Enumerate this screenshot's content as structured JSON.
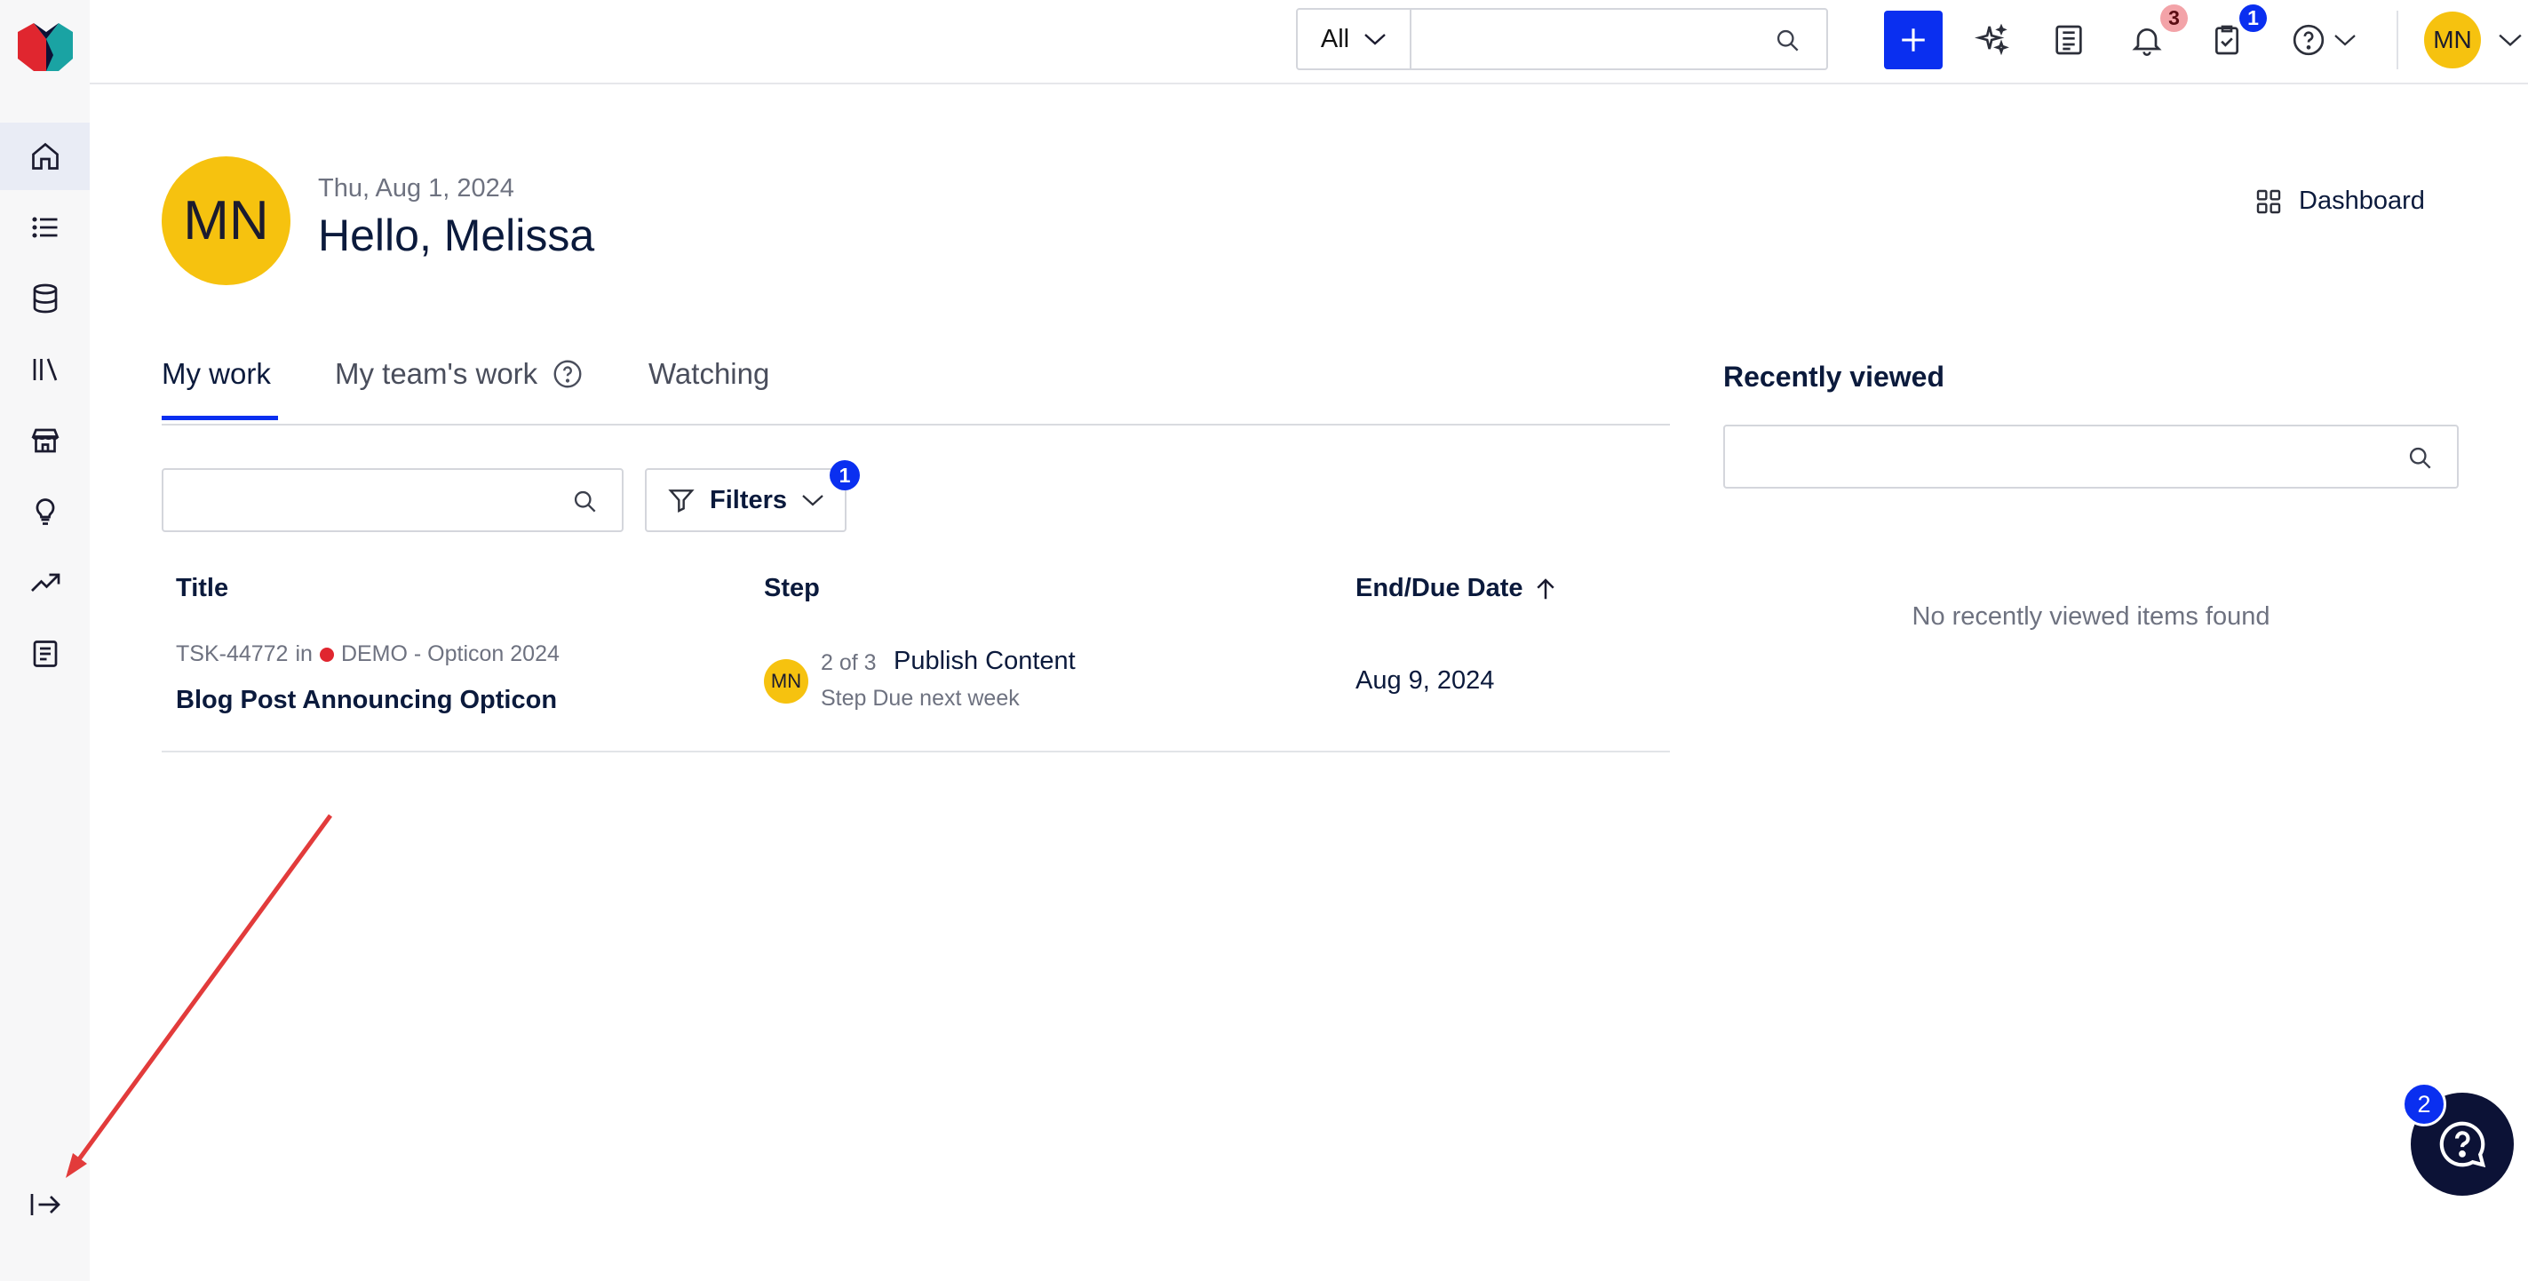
{
  "colors": {
    "accent": "#0a2ff0",
    "avatar": "#f6c20f",
    "bell_badge": "#f3a3a8",
    "task_dot": "#e0262f",
    "help_bubble": "#0c1236"
  },
  "header": {
    "search_type": "All",
    "search_value": "",
    "bell_badge": "3",
    "tasks_badge": "1",
    "user_initials": "MN"
  },
  "sidebar": {
    "items": [
      {
        "name": "home",
        "icon": "home-icon",
        "active": true
      },
      {
        "name": "list",
        "icon": "list-icon"
      },
      {
        "name": "database",
        "icon": "database-icon"
      },
      {
        "name": "library",
        "icon": "library-icon"
      },
      {
        "name": "store",
        "icon": "store-icon"
      },
      {
        "name": "ideas",
        "icon": "lightbulb-icon"
      },
      {
        "name": "analytics",
        "icon": "trending-up-icon"
      },
      {
        "name": "documents",
        "icon": "document-icon"
      }
    ],
    "expand_icon": "expand-sidebar-icon"
  },
  "greeting": {
    "initials": "MN",
    "date": "Thu, Aug 1, 2024",
    "hello": "Hello, Melissa",
    "dashboard_label": "Dashboard"
  },
  "tabs": [
    {
      "label": "My work",
      "active": true
    },
    {
      "label": "My team's work"
    },
    {
      "label": "Watching"
    }
  ],
  "work": {
    "search_value": "",
    "filters_label": "Filters",
    "filters_badge": "1",
    "columns": {
      "title": "Title",
      "step": "Step",
      "due": "End/Due Date"
    },
    "rows": [
      {
        "id": "TSK-44772",
        "in": "in",
        "project": "DEMO - Opticon 2024",
        "title": "Blog Post Announcing Opticon",
        "assignee": "MN",
        "step_count": "2 of 3",
        "step_name": "Publish Content",
        "step_due": "Step Due next week",
        "due_date": "Aug 9, 2024"
      }
    ]
  },
  "recent": {
    "title": "Recently viewed",
    "search_value": "",
    "empty": "No recently viewed items found"
  },
  "help_widget": {
    "badge": "2"
  }
}
